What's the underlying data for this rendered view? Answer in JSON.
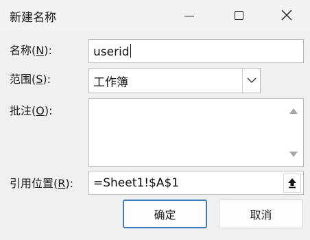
{
  "dialog": {
    "title": "新建名称"
  },
  "fields": {
    "name_label": "名称(N):",
    "name_value": "userid",
    "scope_label": "范围(S):",
    "scope_value": "工作簿",
    "comment_label": "批注(O):",
    "comment_value": "",
    "refers_to_label": "引用位置(R):",
    "refers_to_value": "=Sheet1!$A$1"
  },
  "buttons": {
    "ok_label": "确定",
    "cancel_label": "取消"
  },
  "icons": {
    "minimize": "minimize-icon",
    "maximize": "maximize-icon",
    "close": "close-icon",
    "dropdown": "chevron-down-icon",
    "scroll_up": "scroll-up-arrow-icon",
    "scroll_down": "scroll-down-arrow-icon",
    "collapse": "collapse-dialog-icon"
  }
}
